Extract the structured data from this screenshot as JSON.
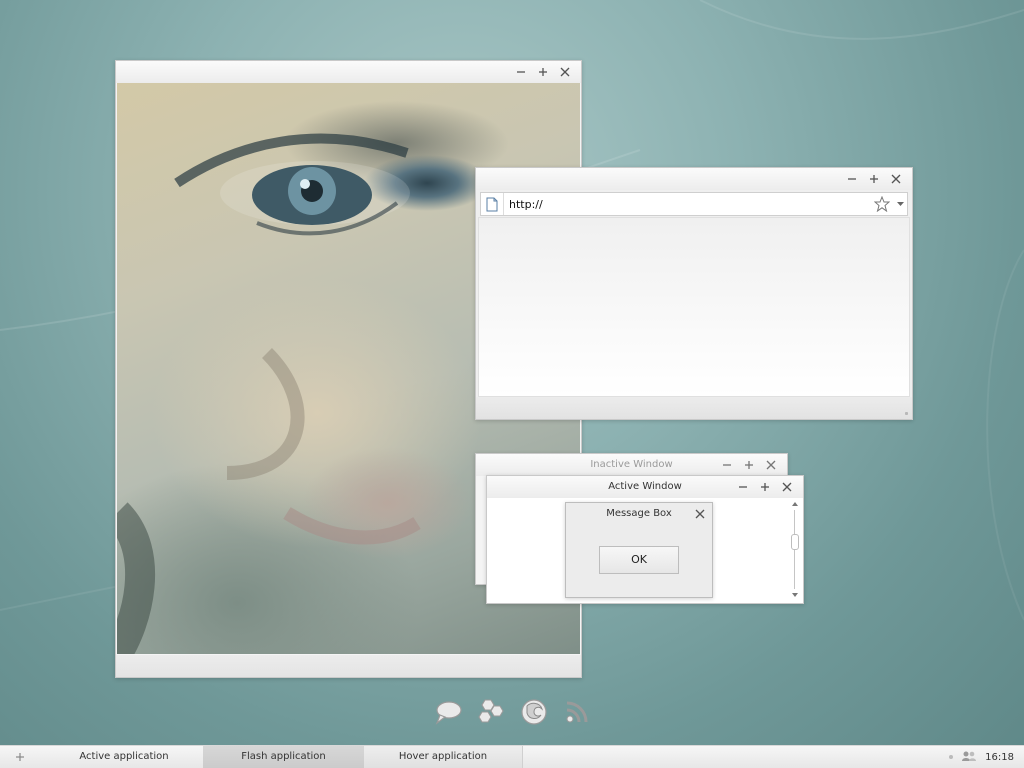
{
  "colors": {
    "desktop_bg": "#8db2b2",
    "window_bg": "#f4f4f4",
    "flash_task_bg": "#cfcfcf"
  },
  "photo_window": {
    "controls": [
      "minimize-icon",
      "maximize-icon",
      "close-icon"
    ]
  },
  "browser": {
    "url": "http://",
    "icons": [
      "page-icon",
      "star-icon",
      "dropdown-icon"
    ]
  },
  "inactive_window": {
    "title": "Inactive Window"
  },
  "active_window": {
    "title": "Active Window"
  },
  "message_box": {
    "title": "Message Box",
    "ok_label": "OK"
  },
  "dock": {
    "items": [
      "chat-icon",
      "hexagons-icon",
      "firefox-icon",
      "rss-icon"
    ]
  },
  "taskbar": {
    "add_icon": "plus-icon",
    "tasks": [
      {
        "label": "Active application",
        "state": "normal"
      },
      {
        "label": "Flash application",
        "state": "flashing"
      },
      {
        "label": "Hover application",
        "state": "hover"
      }
    ],
    "tray": {
      "clock": "16:18",
      "icon": "users-icon"
    }
  }
}
